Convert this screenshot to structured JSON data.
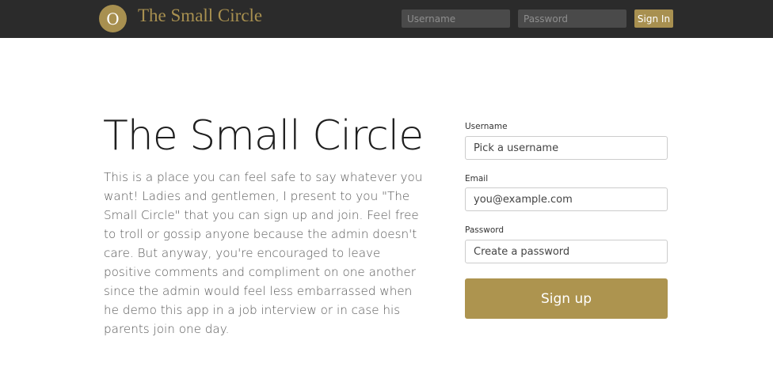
{
  "navbar": {
    "logo_letter": "O",
    "brand": "The Small Circle",
    "username_placeholder": "Username",
    "password_placeholder": "Password",
    "signin_label": "Sign In"
  },
  "hero": {
    "title": "The Small Circle",
    "description": "This is a place you can feel safe to say whatever you want! Ladies and gentlemen, I present to you \"The Small Circle\" that you can sign up and join. Feel free to troll or gossip anyone because the admin doesn't care. But anyway, you're encouraged to leave positive comments and compliment on one another since the admin would feel less embarrassed when he demo this app in a job interview or in case his parents join one day."
  },
  "signup_form": {
    "username_label": "Username",
    "username_placeholder": "Pick a username",
    "email_label": "Email",
    "email_placeholder": "you@example.com",
    "password_label": "Password",
    "password_placeholder": "Create a password",
    "submit_label": "Sign up"
  },
  "colors": {
    "accent": "#a89050",
    "navbar_bg": "#2b2b2b"
  }
}
